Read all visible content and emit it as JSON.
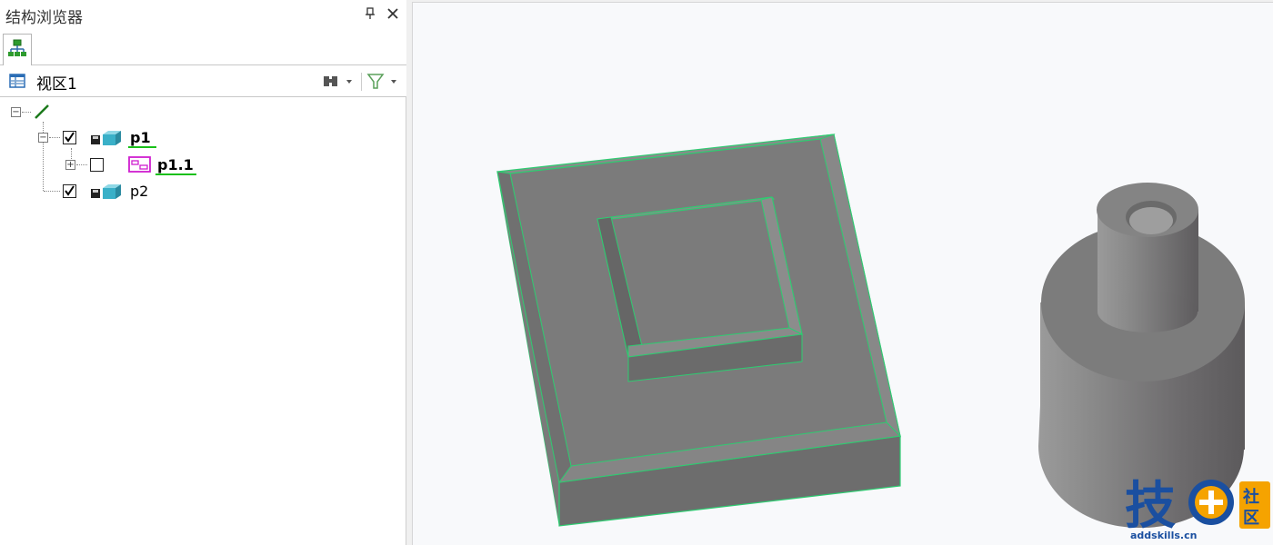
{
  "panel": {
    "title": "结构浏览器"
  },
  "view_bar": {
    "label": "视区1"
  },
  "tree": {
    "nodes": [
      {
        "label": "p1",
        "checked": true
      },
      {
        "label": "p1.1",
        "checked": false
      },
      {
        "label": "p2",
        "checked": true
      }
    ]
  },
  "watermark": {
    "main_char": "技",
    "side_chars": "社区",
    "site": "addskills.cn"
  },
  "colors": {
    "accent_green": "#19c019",
    "model_gray": "#7a7a7a",
    "edge_green": "#2ecc71",
    "brand_blue": "#1a4fa0",
    "brand_orange": "#f5a300"
  },
  "icons": [
    "pin-icon",
    "close-icon",
    "structure-tree-icon",
    "view-icon",
    "binoculars-icon",
    "filter-icon",
    "sketch-line-icon",
    "part-icon",
    "assembly-icon"
  ]
}
